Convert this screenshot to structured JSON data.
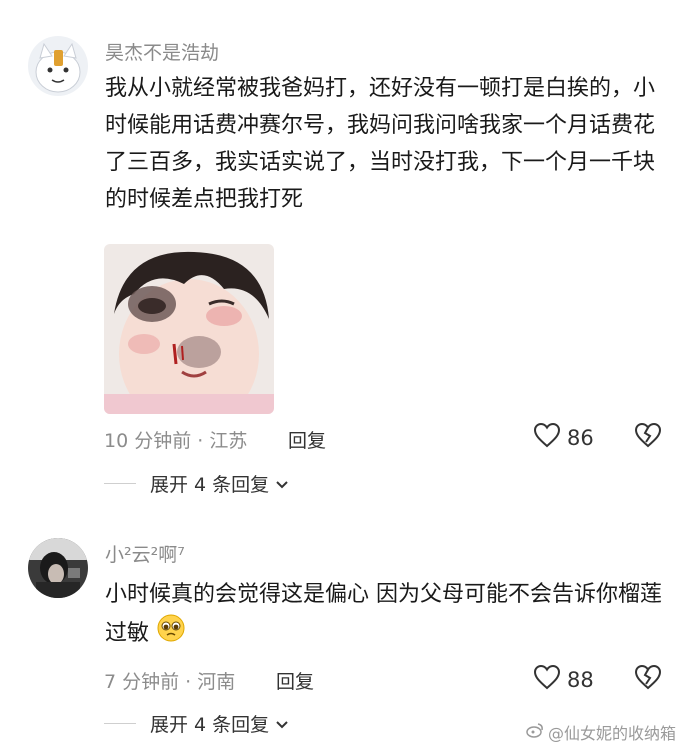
{
  "comments": [
    {
      "username": "昊杰不是浩劫",
      "text": "我从小就经常被我爸妈打，还好没有一顿打是白挨的，小时候能用话费冲赛尔号，我妈问我问啥我家一个月话费花了三百多，我实话实说了，当时没打我，下一个月一千块的时候差点把我打死",
      "time_location": "10 分钟前 · 江苏",
      "reply_label": "回复",
      "likes": "86",
      "expand_label": "展开 4 条回复"
    },
    {
      "username": "小²云²啊⁷",
      "text": "小时候真的会觉得这是偏心 因为父母可能不会告诉你榴莲过敏",
      "time_location": "7 分钟前 · 河南",
      "reply_label": "回复",
      "likes": "88",
      "expand_label": "展开 4 条回复"
    }
  ],
  "watermark": "@仙女妮的收纳箱",
  "icons": {
    "like": "heart-outline-icon",
    "dislike": "broken-heart-icon",
    "expand": "chevron-down-icon",
    "emoji": "pleading-face-emoji"
  }
}
